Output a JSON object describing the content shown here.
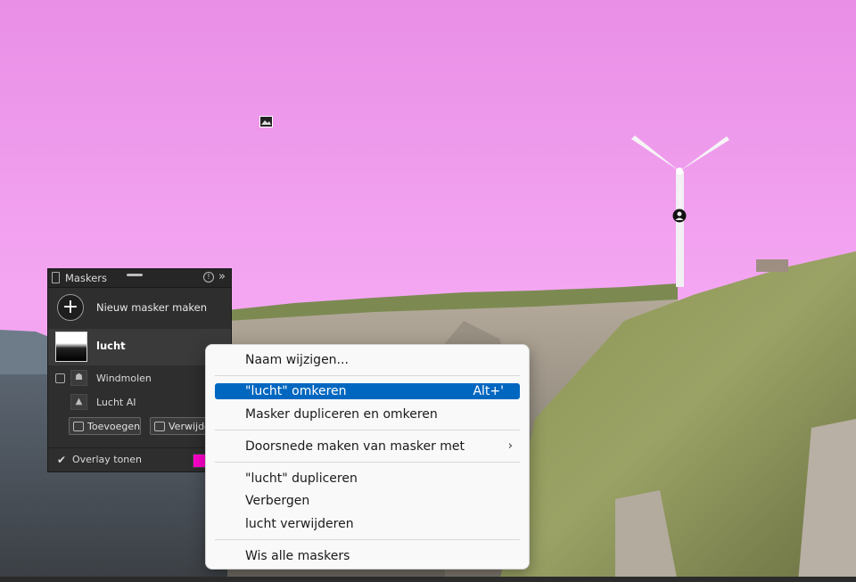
{
  "colors": {
    "sky_overlay": "#f2a0f0",
    "menu_highlight": "#0067c0",
    "overlay_swatch": "#ff00cc"
  },
  "canvas_pins": [
    {
      "icon": "image-pin-icon"
    },
    {
      "icon": "person-pin-icon"
    }
  ],
  "panel": {
    "title": "Maskers",
    "help_icon": "help-circle-icon",
    "more_icon": "double-chevron-right-icon",
    "new_mask_label": "Nieuw masker maken",
    "mask": {
      "name": "lucht",
      "components": [
        {
          "label": "Windmolen",
          "icon": "person-subject-icon"
        },
        {
          "label": "Lucht AI",
          "icon": "sky-landscape-icon"
        }
      ]
    },
    "add_button": "Toevoegen",
    "remove_button": "Verwijde",
    "overlay_label": "Overlay tonen",
    "overlay_checked": true
  },
  "context_menu": {
    "items": [
      {
        "label": "Naam wijzigen...",
        "shortcut": "",
        "submenu": false,
        "highlighted": false
      },
      {
        "label": "\"lucht\" omkeren",
        "shortcut": "Alt+'",
        "submenu": false,
        "highlighted": true
      },
      {
        "label": "Masker dupliceren en omkeren",
        "shortcut": "",
        "submenu": false,
        "highlighted": false
      },
      {
        "label": "Doorsnede maken van masker met",
        "shortcut": "",
        "submenu": true,
        "highlighted": false
      },
      {
        "label": "\"lucht\" dupliceren",
        "shortcut": "",
        "submenu": false,
        "highlighted": false
      },
      {
        "label": "Verbergen",
        "shortcut": "",
        "submenu": false,
        "highlighted": false
      },
      {
        "label": "lucht verwijderen",
        "shortcut": "",
        "submenu": false,
        "highlighted": false
      },
      {
        "label": "Wis alle maskers",
        "shortcut": "",
        "submenu": false,
        "highlighted": false
      }
    ]
  }
}
